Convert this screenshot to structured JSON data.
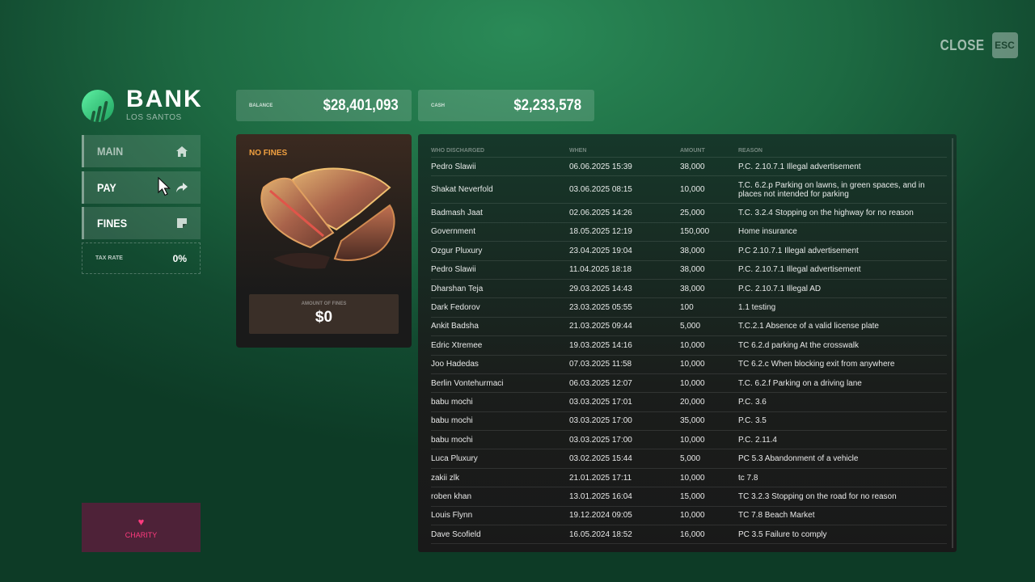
{
  "header": {
    "close_label": "CLOSE",
    "esc_label": "ESC"
  },
  "logo": {
    "title": "BANK",
    "subtitle": "LOS SANTOS",
    "icon": "bank-chart-logo"
  },
  "sidebar": {
    "items": [
      {
        "label": "MAIN",
        "icon": "home-icon"
      },
      {
        "label": "PAY",
        "icon": "share-arrow-icon"
      },
      {
        "label": "FINES",
        "icon": "note-icon"
      }
    ],
    "tax": {
      "label": "TAX RATE",
      "value": "0%"
    },
    "charity": {
      "label": "CHARITY",
      "icon": "heart-icon"
    }
  },
  "stats": {
    "balance": {
      "label": "BALANCE",
      "value": "$28,401,093"
    },
    "cash": {
      "label": "CASH",
      "value": "$2,233,578"
    }
  },
  "fines_card": {
    "title": "NO FINES",
    "amount_label": "AMOUNT OF FINES",
    "amount_value": "$0",
    "colors": {
      "title": "#f0a040"
    }
  },
  "table": {
    "headers": [
      "WHO DISCHARGED",
      "WHEN",
      "AMOUNT",
      "REASON"
    ],
    "rows": [
      [
        "Pedro Slawii",
        "06.06.2025 15:39",
        "38,000",
        "P.C. 2.10.7.1 Illegal advertisement"
      ],
      [
        "Shakat Neverfold",
        "03.06.2025 08:15",
        "10,000",
        "T.C. 6.2.p Parking on lawns, in green spaces, and in places not intended for parking"
      ],
      [
        "Badmash Jaat",
        "02.06.2025 14:26",
        "25,000",
        "T.C. 3.2.4 Stopping on the highway for no reason"
      ],
      [
        "Government",
        "18.05.2025 12:19",
        "150,000",
        "Home insurance"
      ],
      [
        "Ozgur Pluxury",
        "23.04.2025 19:04",
        "38,000",
        "P.C 2.10.7.1 Illegal advertisement"
      ],
      [
        "Pedro Slawii",
        "11.04.2025 18:18",
        "38,000",
        "P.C. 2.10.7.1 Illegal advertisement"
      ],
      [
        "Dharshan Teja",
        "29.03.2025 14:43",
        "38,000",
        "P.C. 2.10.7.1 Illegal AD"
      ],
      [
        "Dark Fedorov",
        "23.03.2025 05:55",
        "100",
        "1.1 testing"
      ],
      [
        "Ankit Badsha",
        "21.03.2025 09:44",
        "5,000",
        "T.C.2.1 Absence of a valid license plate"
      ],
      [
        "Edric Xtremee",
        "19.03.2025 14:16",
        "10,000",
        "TC 6.2.d parking At the crosswalk"
      ],
      [
        "Joo Hadedas",
        "07.03.2025 11:58",
        "10,000",
        "TC 6.2.c When blocking exit from anywhere"
      ],
      [
        "Berlin Vontehurmaci",
        "06.03.2025 12:07",
        "10,000",
        "T.C. 6.2.f Parking on a driving lane"
      ],
      [
        "babu mochi",
        "03.03.2025 17:01",
        "20,000",
        "P.C. 3.6"
      ],
      [
        "babu mochi",
        "03.03.2025 17:00",
        "35,000",
        "P.C. 3.5"
      ],
      [
        "babu mochi",
        "03.03.2025 17:00",
        "10,000",
        "P.C. 2.11.4"
      ],
      [
        "Luca Pluxury",
        "03.02.2025 15:44",
        "5,000",
        "PC 5.3 Abandonment of a vehicle"
      ],
      [
        "zakii zlk",
        "21.01.2025 17:11",
        "10,000",
        "tc 7.8"
      ],
      [
        "roben khan",
        "13.01.2025 16:04",
        "15,000",
        "TC 3.2.3 Stopping on the road for no reason"
      ],
      [
        "Louis Flynn",
        "19.12.2024 09:05",
        "10,000",
        "TC 7.8 Beach Market"
      ],
      [
        "Dave Scofield",
        "16.05.2024 18:52",
        "16,000",
        "PC 3.5 Failure to comply"
      ]
    ]
  }
}
